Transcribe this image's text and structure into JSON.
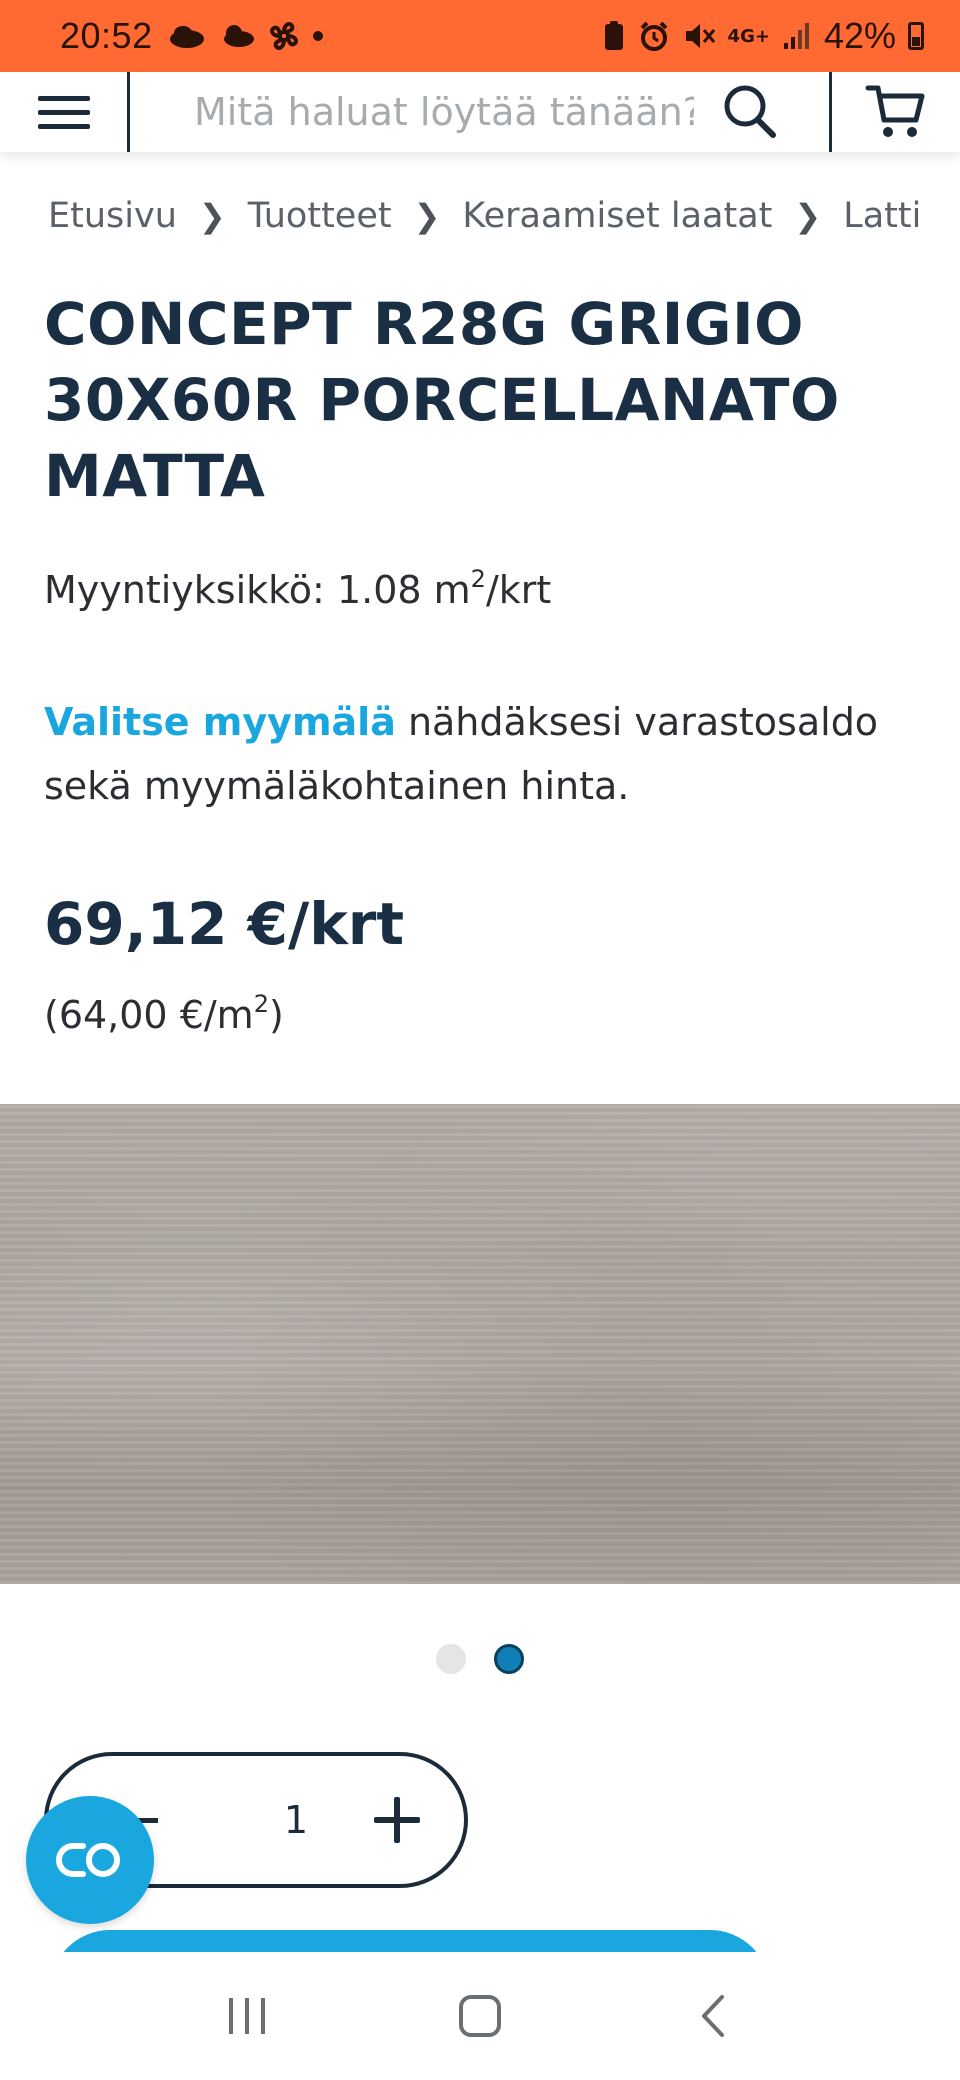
{
  "status_bar": {
    "time": "20:52",
    "network": "4G+",
    "battery": "42%"
  },
  "header": {
    "search_placeholder": "Mitä haluat löytää tänään?"
  },
  "breadcrumb": [
    "Etusivu",
    "Tuotteet",
    "Keraamiset laatat",
    "Lattialaatat"
  ],
  "product": {
    "title": "CONCEPT R28G GRIGIO 30X60R PORCELLANATO MATTA",
    "unit_prefix": "Myyntiyksikkö: 1.08 m",
    "unit_sup": "2",
    "unit_suffix": "/krt",
    "store_link": "Valitse myymälä",
    "store_text": " nähdäksesi varastosaldo sekä myymäläkohtainen hinta.",
    "price": "69,12 €/krt",
    "price_m2_prefix": "(64,00 €/m",
    "price_m2_sup": "2",
    "price_m2_suffix": ")"
  },
  "gallery": {
    "current": 2,
    "total": 2
  },
  "quantity": {
    "value": "1"
  },
  "colors": {
    "status_bar": "#ff6a33",
    "accent": "#1aa7df",
    "heading": "#1a2e44",
    "dot_active": "#0f7fb5"
  }
}
